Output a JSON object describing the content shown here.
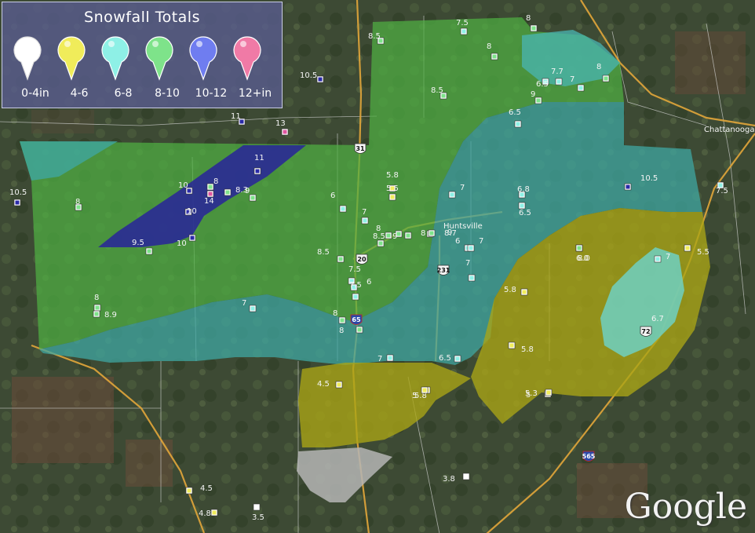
{
  "legend": {
    "title": "Snowfall Totals",
    "items": [
      {
        "label": "0-4in",
        "color": "#ffffff",
        "icon": "white-pin-icon"
      },
      {
        "label": "4-6",
        "color": "#f0ec5a",
        "icon": "yellow-pin-icon"
      },
      {
        "label": "6-8",
        "color": "#8ef0e6",
        "icon": "cyan-pin-icon"
      },
      {
        "label": "8-10",
        "color": "#7ee38a",
        "icon": "green-pin-icon"
      },
      {
        "label": "10-12",
        "color": "#6f7df0",
        "icon": "blue-pin-icon"
      },
      {
        "label": "12+in",
        "color": "#f07aa6",
        "icon": "pink-pin-icon"
      }
    ]
  },
  "zones": [
    {
      "name": "zone-8-10",
      "color": "#4fb043",
      "category": "8-10"
    },
    {
      "name": "zone-6-8",
      "color": "#3fa7a2",
      "category": "6-8"
    },
    {
      "name": "zone-4-6",
      "color": "#aaa516",
      "category": "4-6"
    },
    {
      "name": "zone-10-12",
      "color": "#28239a",
      "category": "10-12"
    },
    {
      "name": "zone-0-4",
      "color": "#b5b5b5",
      "category": "0-4"
    }
  ],
  "highway_shields": [
    "31",
    "20",
    "231",
    "65",
    "72",
    "565"
  ],
  "city_label": "Huntsville",
  "place_label_right": "Chattanooga",
  "observations": [
    {
      "value": "8.5",
      "cat": "8-10"
    },
    {
      "value": "7.5",
      "cat": "6-8"
    },
    {
      "value": "8",
      "cat": "8-10"
    },
    {
      "value": "8",
      "cat": "8-10"
    },
    {
      "value": "8",
      "cat": "8-10"
    },
    {
      "value": "7",
      "cat": "6-8"
    },
    {
      "value": "7.7",
      "cat": "6-8"
    },
    {
      "value": "6.5",
      "cat": "6-8"
    },
    {
      "value": "9",
      "cat": "8-10"
    },
    {
      "value": "6.5",
      "cat": "6-8"
    },
    {
      "value": "8.5",
      "cat": "8-10"
    },
    {
      "value": "10.5",
      "cat": "10-12"
    },
    {
      "value": "11",
      "cat": "10-12"
    },
    {
      "value": "13",
      "cat": "12+"
    },
    {
      "value": "10.5",
      "cat": "10-12"
    },
    {
      "value": "11",
      "cat": "10-12"
    },
    {
      "value": "10",
      "cat": "10-12"
    },
    {
      "value": "8",
      "cat": "8-10"
    },
    {
      "value": "14",
      "cat": "12+"
    },
    {
      "value": "8.3",
      "cat": "8-10"
    },
    {
      "value": "9",
      "cat": "8-10"
    },
    {
      "value": "10",
      "cat": "10-12"
    },
    {
      "value": "9.5",
      "cat": "8-10"
    },
    {
      "value": "10",
      "cat": "10-12"
    },
    {
      "value": "8",
      "cat": "8-10"
    },
    {
      "value": "8",
      "cat": "8-10"
    },
    {
      "value": "8.9",
      "cat": "8-10"
    },
    {
      "value": "5.8",
      "cat": "4-6"
    },
    {
      "value": "5.5",
      "cat": "4-6"
    },
    {
      "value": "7",
      "cat": "6-8"
    },
    {
      "value": "6.8",
      "cat": "6-8"
    },
    {
      "value": "6.5",
      "cat": "6-8"
    },
    {
      "value": "10.5",
      "cat": "10-12"
    },
    {
      "value": "7.5",
      "cat": "6-8"
    },
    {
      "value": "6",
      "cat": "6-8"
    },
    {
      "value": "7",
      "cat": "6-8"
    },
    {
      "value": "8",
      "cat": "8-10"
    },
    {
      "value": "9",
      "cat": "8-10"
    },
    {
      "value": "8",
      "cat": "8-10"
    },
    {
      "value": "8.5",
      "cat": "8-10"
    },
    {
      "value": "8.7",
      "cat": "8-10"
    },
    {
      "value": "9",
      "cat": "8-10"
    },
    {
      "value": "6",
      "cat": "6-8"
    },
    {
      "value": "7",
      "cat": "6-8"
    },
    {
      "value": "7",
      "cat": "6-8"
    },
    {
      "value": "8.5",
      "cat": "8-10"
    },
    {
      "value": "7.5",
      "cat": "6-8"
    },
    {
      "value": "6",
      "cat": "6-8"
    },
    {
      "value": "8",
      "cat": "8-10"
    },
    {
      "value": "7",
      "cat": "6-8"
    },
    {
      "value": "5.8",
      "cat": "4-6"
    },
    {
      "value": "6.0",
      "cat": "6-8"
    },
    {
      "value": "5.5",
      "cat": "4-6"
    },
    {
      "value": "7",
      "cat": "6-8"
    },
    {
      "value": "5.8",
      "cat": "4-6"
    },
    {
      "value": "5",
      "cat": "4-6"
    },
    {
      "value": "6.7",
      "cat": "6-8"
    },
    {
      "value": "5.8",
      "cat": "4-6"
    },
    {
      "value": "7",
      "cat": "6-8"
    },
    {
      "value": "6.5",
      "cat": "6-8"
    },
    {
      "value": "4.5",
      "cat": "4-6"
    },
    {
      "value": "5",
      "cat": "4-6"
    },
    {
      "value": "5.3",
      "cat": "4-6"
    },
    {
      "value": "8.0",
      "cat": "8-10"
    },
    {
      "value": "7.5",
      "cat": "6-8"
    },
    {
      "value": "8",
      "cat": "8-10"
    },
    {
      "value": "4.5",
      "cat": "4-6"
    },
    {
      "value": "4.8",
      "cat": "4-6"
    },
    {
      "value": "3.5",
      "cat": "0-4"
    },
    {
      "value": "3.8",
      "cat": "0-4"
    }
  ],
  "attribution": "Google"
}
